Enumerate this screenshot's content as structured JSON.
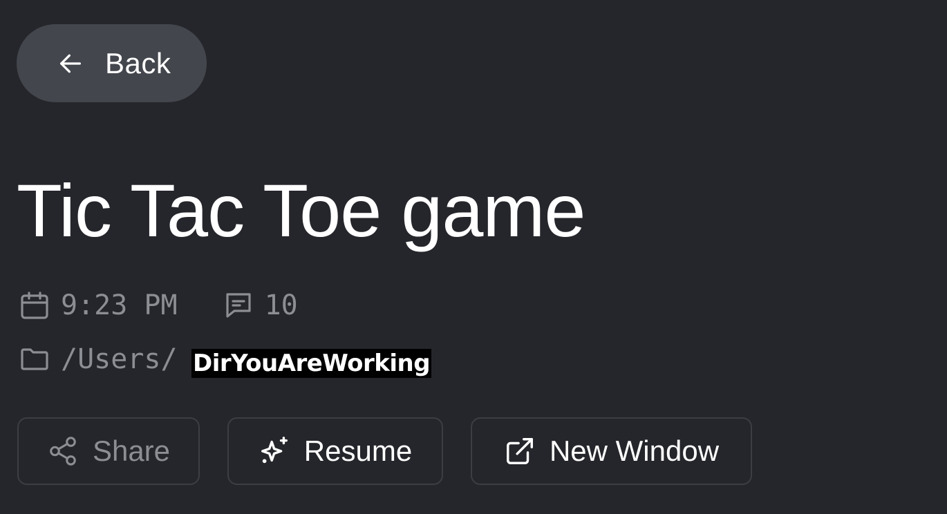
{
  "back_button": {
    "label": "Back",
    "icon": "arrow-left-icon"
  },
  "title": "Tic Tac Toe game",
  "meta": {
    "time": "9:23 PM",
    "time_icon": "calendar-icon",
    "message_count": "10",
    "message_icon": "message-icon",
    "path_prefix": "/Users/",
    "path_icon": "folder-icon",
    "redacted_path": "DirYouAreWorking"
  },
  "actions": {
    "share": {
      "label": "Share",
      "icon": "share-icon"
    },
    "resume": {
      "label": "Resume",
      "icon": "sparkles-icon"
    },
    "new_window": {
      "label": "New Window",
      "icon": "external-link-icon"
    }
  },
  "colors": {
    "background": "#25262b",
    "back_button_bg": "#43464d",
    "muted_text": "#8c8e94",
    "border": "#3c3e44",
    "text": "#ffffff"
  }
}
